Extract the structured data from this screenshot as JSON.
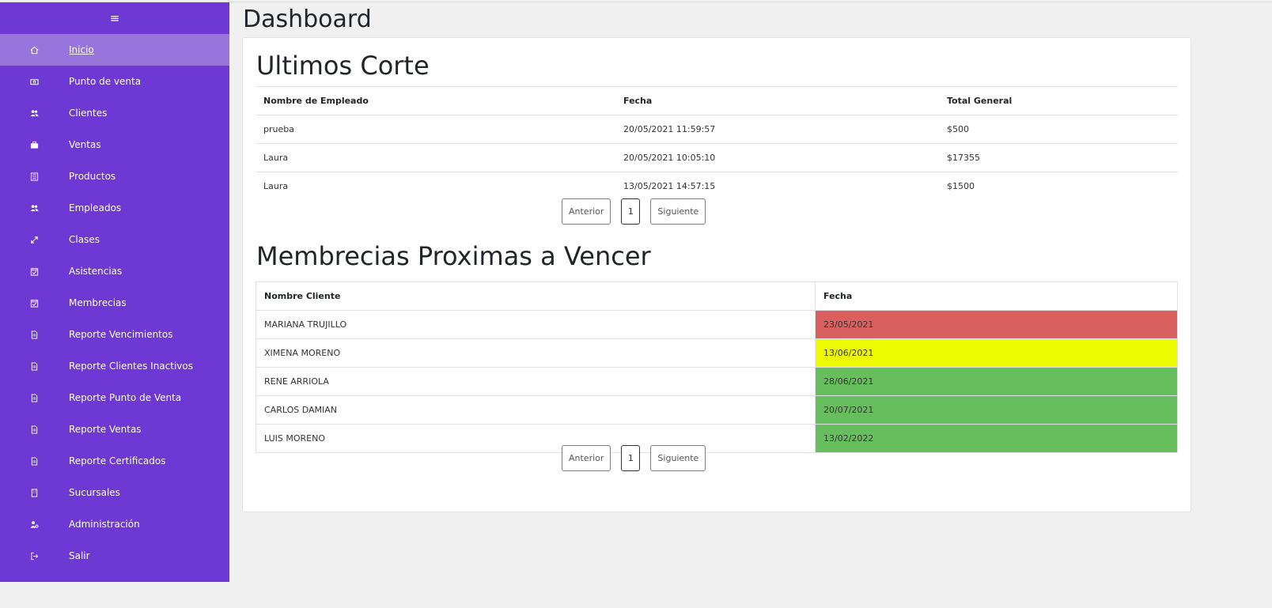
{
  "app": {
    "page_title": "Dashboard"
  },
  "sidebar": {
    "toggle_icon": "hamburger-icon",
    "items": [
      {
        "label": "Inicio",
        "icon": "home-icon",
        "active": true
      },
      {
        "label": "Punto de venta",
        "icon": "cash-icon"
      },
      {
        "label": "Clientes",
        "icon": "users-icon"
      },
      {
        "label": "Ventas",
        "icon": "briefcase-icon"
      },
      {
        "label": "Productos",
        "icon": "list-icon"
      },
      {
        "label": "Empleados",
        "icon": "users-icon"
      },
      {
        "label": "Clases",
        "icon": "expand-icon"
      },
      {
        "label": "Asistencias",
        "icon": "calendar-check-icon"
      },
      {
        "label": "Membrecias",
        "icon": "calendar-check-icon"
      },
      {
        "label": "Reporte Vencimientos",
        "icon": "file-icon"
      },
      {
        "label": "Reporte Clientes Inactivos",
        "icon": "file-icon"
      },
      {
        "label": "Reporte Punto de Venta",
        "icon": "file-icon"
      },
      {
        "label": "Reporte Ventas",
        "icon": "file-icon"
      },
      {
        "label": "Reporte Certificados",
        "icon": "file-icon"
      },
      {
        "label": "Sucursales",
        "icon": "building-icon"
      },
      {
        "label": "Administración",
        "icon": "user-gear-icon"
      },
      {
        "label": "Salir",
        "icon": "logout-icon"
      }
    ]
  },
  "cortes": {
    "title": "Ultimos Corte",
    "columns": [
      "Nombre de Empleado",
      "Fecha",
      "Total General"
    ],
    "rows": [
      [
        "prueba",
        "20/05/2021 11:59:57",
        "$500"
      ],
      [
        "Laura",
        "20/05/2021 10:05:10",
        "$17355"
      ],
      [
        "Laura",
        "13/05/2021 14:57:15",
        "$1500"
      ]
    ],
    "pagination": {
      "prev": "Anterior",
      "page": "1",
      "next": "Siguiente"
    }
  },
  "membrecias": {
    "title": "Membrecias Proximas a Vencer",
    "columns": [
      "Nombre Cliente",
      "Fecha"
    ],
    "rows": [
      {
        "name": "MARIANA TRUJILLO",
        "date": "23/05/2021",
        "status": "red"
      },
      {
        "name": "XIMENA MORENO",
        "date": "13/06/2021",
        "status": "yellow"
      },
      {
        "name": "RENE ARRIOLA",
        "date": "28/06/2021",
        "status": "green"
      },
      {
        "name": "CARLOS DAMIAN",
        "date": "20/07/2021",
        "status": "green"
      },
      {
        "name": "LUIS MORENO",
        "date": "13/02/2022",
        "status": "green"
      }
    ],
    "pagination": {
      "prev": "Anterior",
      "page": "1",
      "next": "Siguiente"
    }
  },
  "colors": {
    "sidebar_bg": "#6d38d3",
    "sidebar_active": "#9775dd",
    "status_red": "#d9605f",
    "status_yellow": "#eefa00",
    "status_green": "#67be5c"
  }
}
